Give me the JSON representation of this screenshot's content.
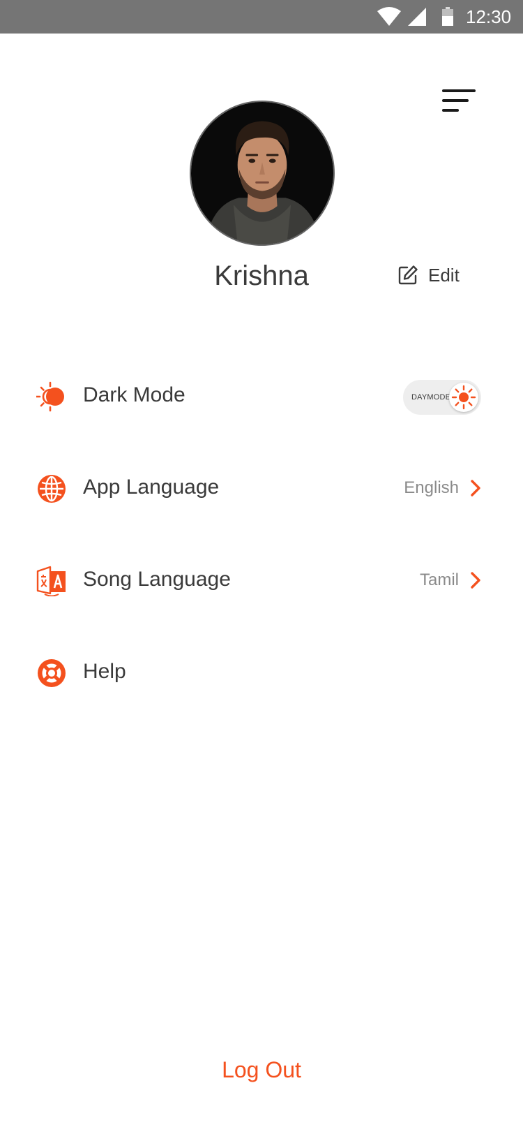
{
  "status_bar": {
    "time": "12:30",
    "icons": [
      "wifi-icon",
      "cellular-signal-icon",
      "battery-icon"
    ]
  },
  "header": {
    "menu_icon": "hamburger-menu-icon"
  },
  "profile": {
    "name": "Krishna",
    "edit_label": "Edit",
    "edit_icon": "edit-icon",
    "avatar": "avatar"
  },
  "settings": {
    "dark_mode": {
      "label": "Dark Mode",
      "icon": "day-night-icon",
      "toggle_label": "DAYMODE",
      "toggle_icon": "sun-icon",
      "enabled": false
    },
    "app_language": {
      "label": "App Language",
      "icon": "globe-icon",
      "value": "English"
    },
    "song_language": {
      "label": "Song Language",
      "icon": "translate-icon",
      "value": "Tamil"
    },
    "help": {
      "label": "Help",
      "icon": "lifebuoy-icon"
    }
  },
  "footer": {
    "logout_label": "Log Out"
  },
  "colors": {
    "accent": "#f4511e",
    "text": "#3a3a3a",
    "muted_text": "#8a8a8a",
    "status_bar": "#757575",
    "toggle_track": "#eeeeee"
  }
}
